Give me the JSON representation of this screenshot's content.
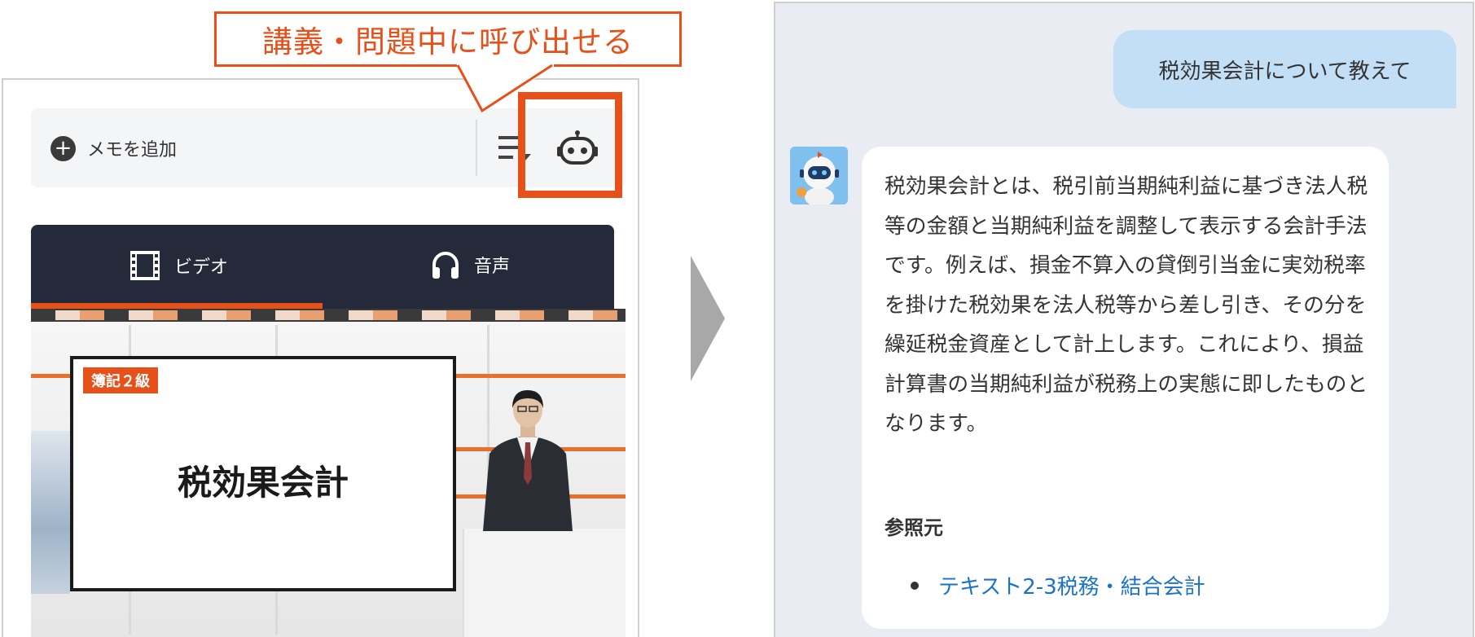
{
  "callout": {
    "text": "講義・問題中に呼び出せる"
  },
  "memo_bar": {
    "add_memo_label": "メモを追加"
  },
  "video_player": {
    "tabs": [
      {
        "label": "ビデオ",
        "icon": "film-icon",
        "active": true
      },
      {
        "label": "音声",
        "icon": "headphones-icon",
        "active": false
      }
    ],
    "slide_badge": "簿記２級",
    "slide_title": "税効果会計"
  },
  "chat": {
    "user_message": "税効果会計について教えて",
    "bot_message": "税効果会計とは、税引前当期純利益に基づき法人税等の金額と当期純利益を調整して表示する会計手法です。例えば、損金不算入の貸倒引当金に実効税率を掛けた税効果を法人税等から差し引き、その分を繰延税金資産として計上します。これにより、損益計算書の当期純利益が税務上の実態に即したものとなります。",
    "reference_heading": "参照元",
    "references": [
      {
        "label": "テキスト2-3税務・結合会計"
      }
    ]
  },
  "colors": {
    "accent": "#e8501a",
    "tab_bar": "#252a3a",
    "user_bubble": "#c3dff6",
    "chat_bg": "#e9ecf2",
    "link": "#1a73c9"
  }
}
